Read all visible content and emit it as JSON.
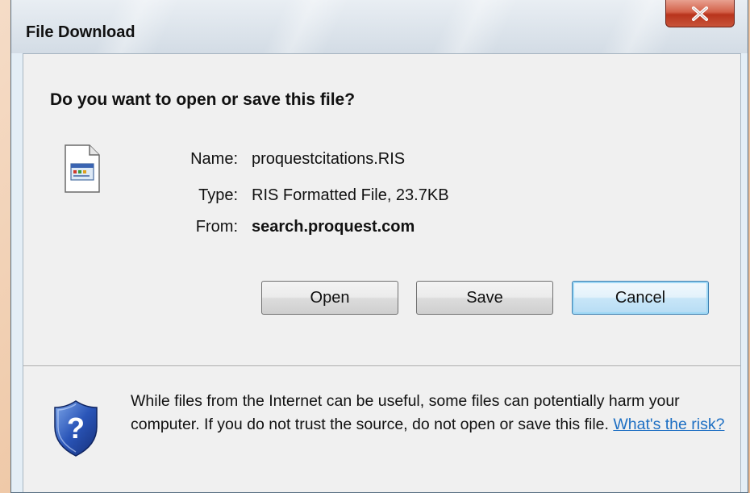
{
  "window": {
    "title": "File Download",
    "close_label": "X"
  },
  "dialog": {
    "question": "Do you want to open or save this file?",
    "file": {
      "icon": "ris-file-icon",
      "name_label": "Name:",
      "name_value": "proquestcitations.RIS",
      "type_label": "Type:",
      "type_value": "RIS Formatted File, 23.7KB",
      "from_label": "From:",
      "from_value": "search.proquest.com"
    },
    "buttons": {
      "open": "Open",
      "save": "Save",
      "cancel": "Cancel"
    },
    "warning": {
      "icon": "shield-question-icon",
      "text": "While files from the Internet can be useful, some files can potentially harm your computer. If you do not trust the source, do not open or save this file.",
      "link": "What's the risk?"
    }
  },
  "colors": {
    "close_button": "#c8543a",
    "link": "#1d6fc3",
    "shield": "#2a55b8"
  }
}
